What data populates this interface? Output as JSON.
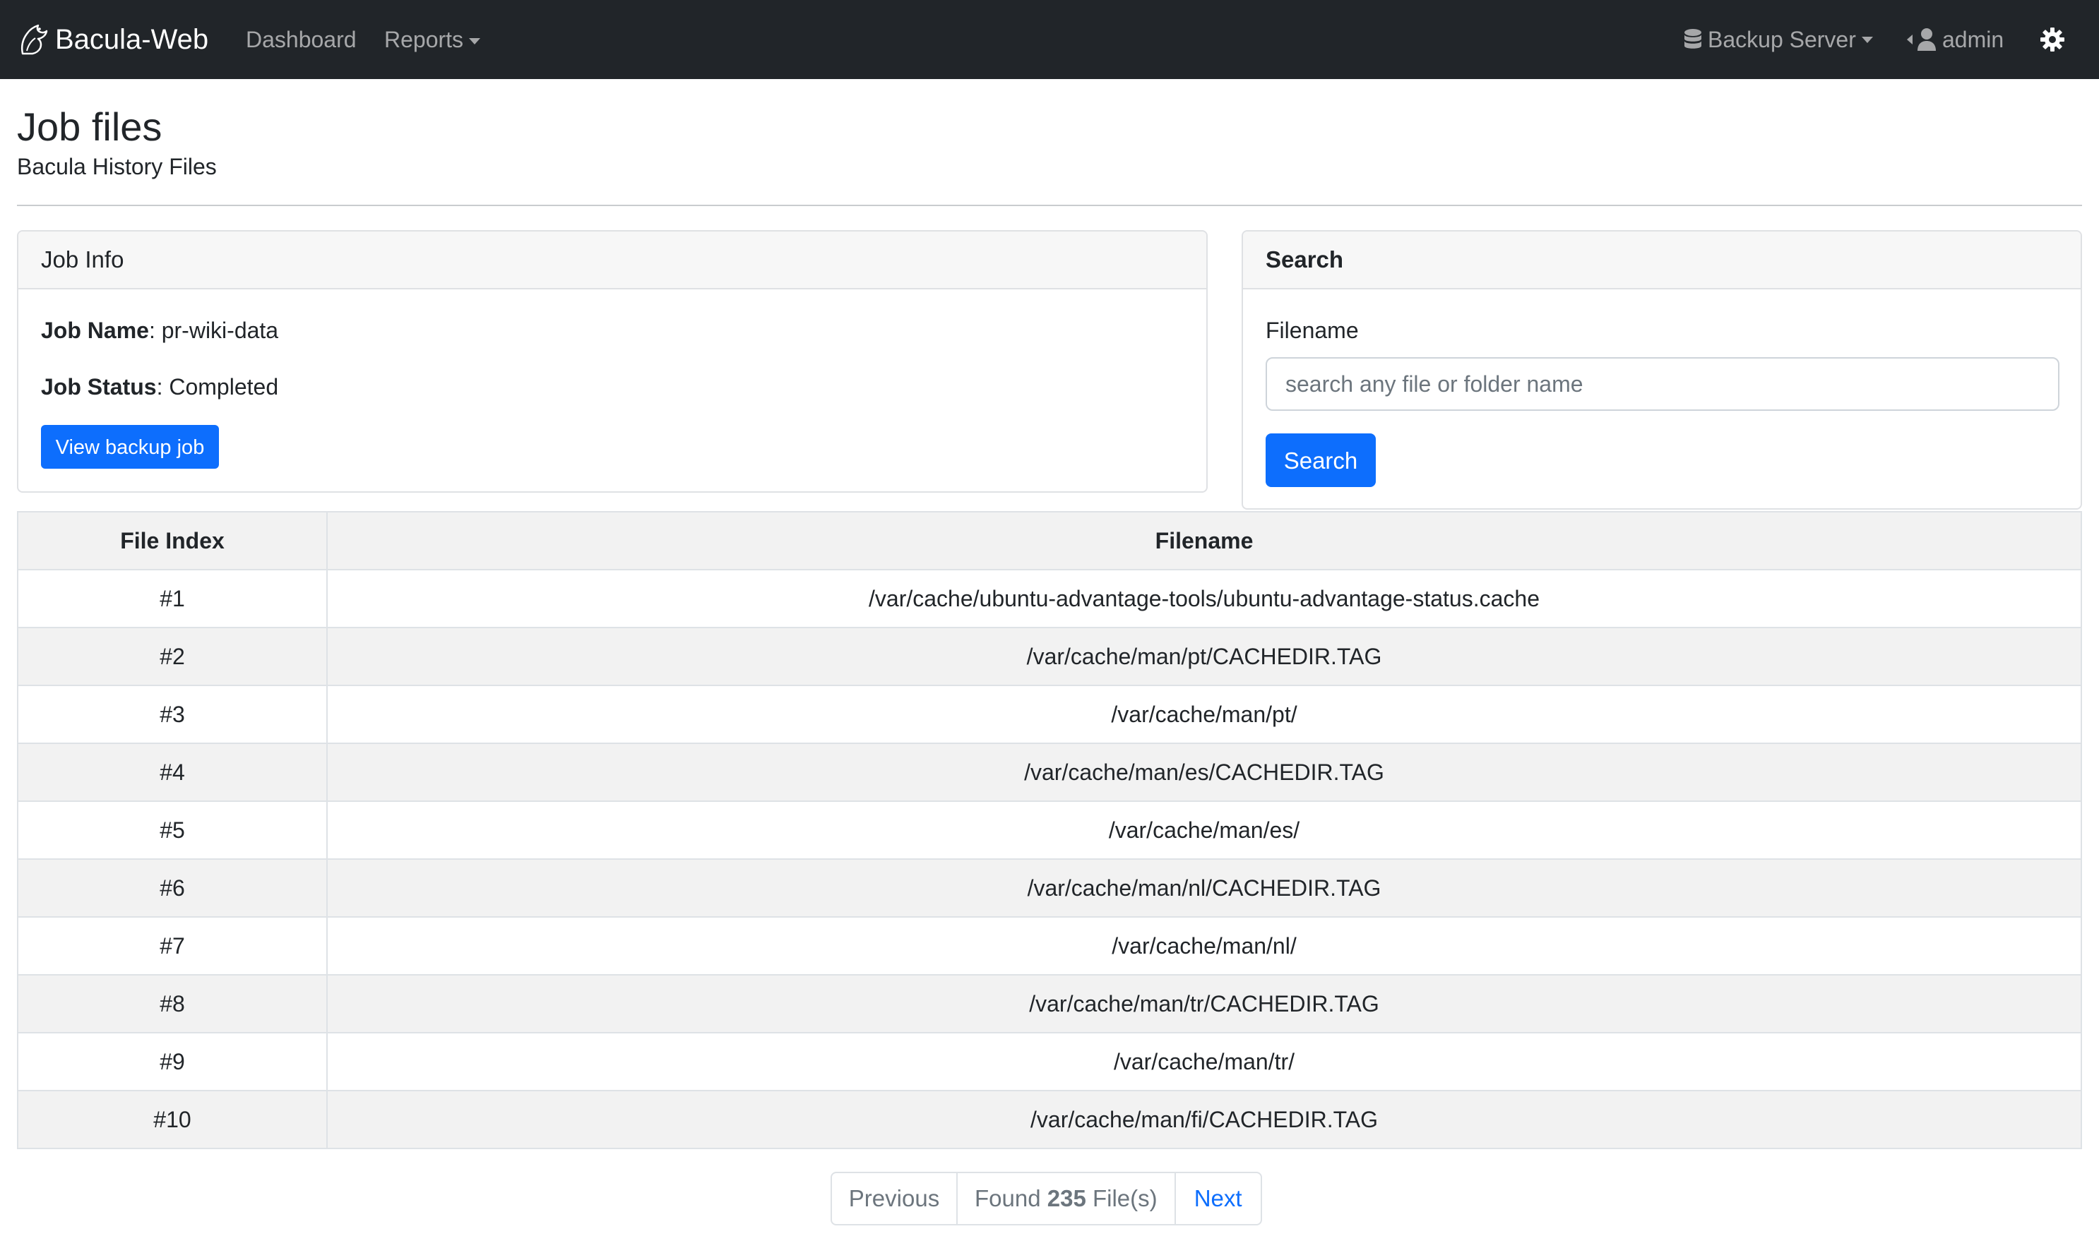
{
  "navbar": {
    "brand": "Bacula-Web",
    "links": {
      "dashboard": "Dashboard",
      "reports": "Reports"
    },
    "server_label": "Backup Server",
    "user_label": "admin",
    "icons": {
      "brand": "bacula-logo-icon",
      "server": "database-icon",
      "user": "user-icon",
      "settings": "gear-icon"
    }
  },
  "header": {
    "title": "Job files",
    "subtitle": "Bacula History Files"
  },
  "job_info": {
    "header": "Job Info",
    "name_label": "Job Name",
    "name_value": "pr-wiki-data",
    "status_label": "Job Status",
    "status_value": "Completed",
    "view_button": "View backup job"
  },
  "search": {
    "header": "Search",
    "field_label": "Filename",
    "placeholder": "search any file or folder name",
    "button": "Search"
  },
  "table": {
    "headers": {
      "index": "File Index",
      "filename": "Filename"
    },
    "rows": [
      {
        "index": "#1",
        "filename": "/var/cache/ubuntu-advantage-tools/ubuntu-advantage-status.cache"
      },
      {
        "index": "#2",
        "filename": "/var/cache/man/pt/CACHEDIR.TAG"
      },
      {
        "index": "#3",
        "filename": "/var/cache/man/pt/"
      },
      {
        "index": "#4",
        "filename": "/var/cache/man/es/CACHEDIR.TAG"
      },
      {
        "index": "#5",
        "filename": "/var/cache/man/es/"
      },
      {
        "index": "#6",
        "filename": "/var/cache/man/nl/CACHEDIR.TAG"
      },
      {
        "index": "#7",
        "filename": "/var/cache/man/nl/"
      },
      {
        "index": "#8",
        "filename": "/var/cache/man/tr/CACHEDIR.TAG"
      },
      {
        "index": "#9",
        "filename": "/var/cache/man/tr/"
      },
      {
        "index": "#10",
        "filename": "/var/cache/man/fi/CACHEDIR.TAG"
      }
    ]
  },
  "pagination": {
    "previous": "Previous",
    "found_prefix": "Found",
    "found_count": "235",
    "found_suffix": "File(s)",
    "next": "Next"
  },
  "colors": {
    "navbar": "#212529",
    "primary": "#0d6efd",
    "stripe": "#f2f2f2"
  }
}
